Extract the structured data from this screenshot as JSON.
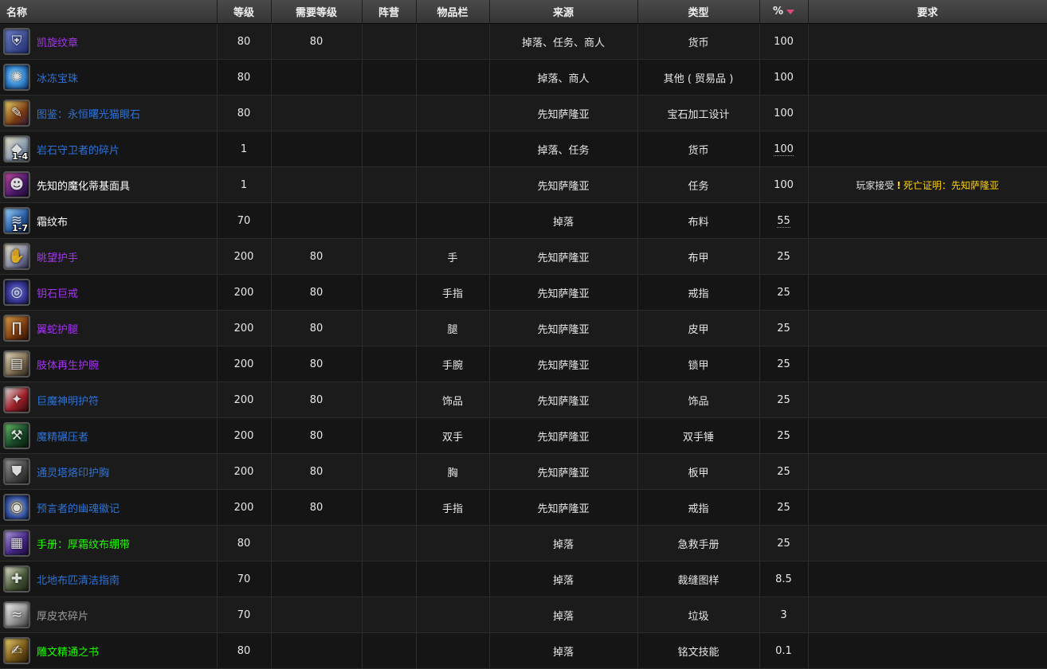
{
  "headers": {
    "name": "名称",
    "level": "等级",
    "req_level": "需要等级",
    "faction": "阵营",
    "slot": "物品栏",
    "source": "来源",
    "type": "类型",
    "percent": "%",
    "requirements": "要求"
  },
  "colors": {
    "epic": "#a335ee",
    "rare": "#2d73d9",
    "uncommon": "#1eff00",
    "common": "#ffffff",
    "poor": "#9d9d9d",
    "quest": "#ffd100",
    "sort_arrow": "#e34a7a"
  },
  "rows": [
    {
      "name": "凯旋纹章",
      "quality": "epic",
      "icon": "emblem-icon",
      "level": "80",
      "req_level": "80",
      "faction": "",
      "slot": "",
      "source": "掉落、任务、商人",
      "type": "货币",
      "percent": "100",
      "percent_dotted": false,
      "qty": "",
      "requirements": null
    },
    {
      "name": "冰冻宝珠",
      "quality": "rare",
      "icon": "frozen-orb-icon",
      "level": "80",
      "req_level": "",
      "faction": "",
      "slot": "",
      "source": "掉落、商人",
      "type": "其他 ( 贸易品 )",
      "percent": "100",
      "percent_dotted": false,
      "qty": "",
      "requirements": null
    },
    {
      "name": "图鉴：永恒曙光猫眼石",
      "quality": "rare",
      "icon": "design-scroll-icon",
      "level": "80",
      "req_level": "",
      "faction": "",
      "slot": "",
      "source": "先知萨隆亚",
      "type": "宝石加工设计",
      "percent": "100",
      "percent_dotted": false,
      "qty": "",
      "requirements": null
    },
    {
      "name": "岩石守卫者的碎片",
      "quality": "rare",
      "icon": "stone-shard-icon",
      "level": "1",
      "req_level": "",
      "faction": "",
      "slot": "",
      "source": "掉落、任务",
      "type": "货币",
      "percent": "100",
      "percent_dotted": true,
      "qty": "1-4",
      "requirements": null
    },
    {
      "name": "先知的魔化蒂基面具",
      "quality": "common",
      "icon": "tiki-mask-icon",
      "level": "1",
      "req_level": "",
      "faction": "",
      "slot": "",
      "source": "先知萨隆亚",
      "type": "任务",
      "percent": "100",
      "percent_dotted": false,
      "qty": "",
      "requirements": {
        "prefix": "玩家接受",
        "mark": "!",
        "quest": "死亡证明：先知萨隆亚"
      }
    },
    {
      "name": "霜纹布",
      "quality": "common",
      "icon": "frostweave-cloth-icon",
      "level": "70",
      "req_level": "",
      "faction": "",
      "slot": "",
      "source": "掉落",
      "type": "布料",
      "percent": "55",
      "percent_dotted": true,
      "qty": "1-7",
      "requirements": null
    },
    {
      "name": "眺望护手",
      "quality": "epic",
      "icon": "gauntlets-icon",
      "level": "200",
      "req_level": "80",
      "faction": "",
      "slot": "手",
      "source": "先知萨隆亚",
      "type": "布甲",
      "percent": "25",
      "percent_dotted": false,
      "qty": "",
      "requirements": null
    },
    {
      "name": "钥石巨戒",
      "quality": "epic",
      "icon": "ring-icon",
      "level": "200",
      "req_level": "80",
      "faction": "",
      "slot": "手指",
      "source": "先知萨隆亚",
      "type": "戒指",
      "percent": "25",
      "percent_dotted": false,
      "qty": "",
      "requirements": null
    },
    {
      "name": "翼蛇护腿",
      "quality": "epic",
      "icon": "leggings-icon",
      "level": "200",
      "req_level": "80",
      "faction": "",
      "slot": "腿",
      "source": "先知萨隆亚",
      "type": "皮甲",
      "percent": "25",
      "percent_dotted": false,
      "qty": "",
      "requirements": null
    },
    {
      "name": "肢体再生护腕",
      "quality": "epic",
      "icon": "bracer-icon",
      "level": "200",
      "req_level": "80",
      "faction": "",
      "slot": "手腕",
      "source": "先知萨隆亚",
      "type": "锁甲",
      "percent": "25",
      "percent_dotted": false,
      "qty": "",
      "requirements": null
    },
    {
      "name": "巨魔神明护符",
      "quality": "rare",
      "icon": "talisman-icon",
      "level": "200",
      "req_level": "80",
      "faction": "",
      "slot": "饰品",
      "source": "先知萨隆亚",
      "type": "饰品",
      "percent": "25",
      "percent_dotted": false,
      "qty": "",
      "requirements": null
    },
    {
      "name": "魔精碾压者",
      "quality": "rare",
      "icon": "mace-icon",
      "level": "200",
      "req_level": "80",
      "faction": "",
      "slot": "双手",
      "source": "先知萨隆亚",
      "type": "双手锤",
      "percent": "25",
      "percent_dotted": false,
      "qty": "",
      "requirements": null
    },
    {
      "name": "通灵塔烙印护胸",
      "quality": "rare",
      "icon": "breastplate-icon",
      "level": "200",
      "req_level": "80",
      "faction": "",
      "slot": "胸",
      "source": "先知萨隆亚",
      "type": "板甲",
      "percent": "25",
      "percent_dotted": false,
      "qty": "",
      "requirements": null
    },
    {
      "name": "预言者的幽魂徽记",
      "quality": "rare",
      "icon": "signet-icon",
      "level": "200",
      "req_level": "80",
      "faction": "",
      "slot": "手指",
      "source": "先知萨隆亚",
      "type": "戒指",
      "percent": "25",
      "percent_dotted": false,
      "qty": "",
      "requirements": null
    },
    {
      "name": "手册：厚霜纹布绷带",
      "quality": "uncommon",
      "icon": "manual-book-icon",
      "level": "80",
      "req_level": "",
      "faction": "",
      "slot": "",
      "source": "掉落",
      "type": "急救手册",
      "percent": "25",
      "percent_dotted": false,
      "qty": "",
      "requirements": null
    },
    {
      "name": "北地布匹清洁指南",
      "quality": "rare",
      "icon": "pattern-book-icon",
      "level": "70",
      "req_level": "",
      "faction": "",
      "slot": "",
      "source": "掉落",
      "type": "裁缝图样",
      "percent": "8.5",
      "percent_dotted": false,
      "qty": "",
      "requirements": null
    },
    {
      "name": "厚皮衣碎片",
      "quality": "poor",
      "icon": "hide-scrap-icon",
      "level": "70",
      "req_level": "",
      "faction": "",
      "slot": "",
      "source": "掉落",
      "type": "垃圾",
      "percent": "3",
      "percent_dotted": false,
      "qty": "",
      "requirements": null
    },
    {
      "name": "雕文精通之书",
      "quality": "uncommon",
      "icon": "inscription-book-icon",
      "level": "80",
      "req_level": "",
      "faction": "",
      "slot": "",
      "source": "掉落",
      "type": "铭文技能",
      "percent": "0.1",
      "percent_dotted": false,
      "qty": "",
      "requirements": null
    }
  ]
}
